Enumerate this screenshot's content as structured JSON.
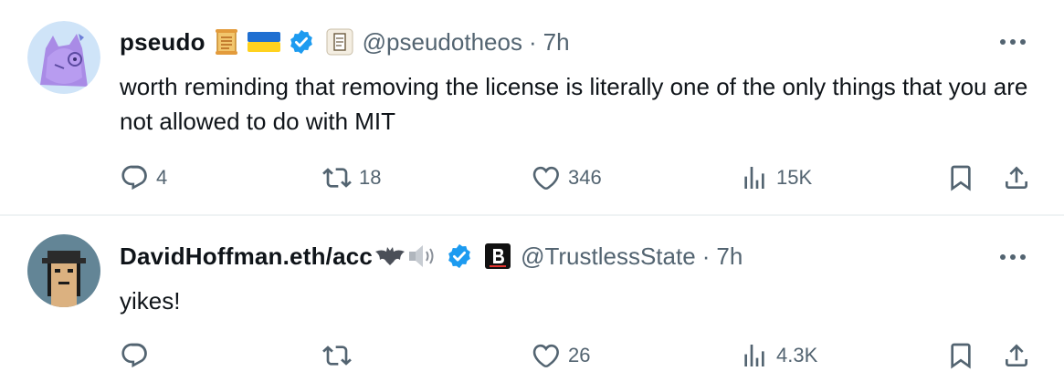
{
  "tweets": [
    {
      "name": "pseudo",
      "handle": "@pseudotheos",
      "dot": "·",
      "time": "7h",
      "text": "worth reminding that removing the license is literally one of the only things that you are not allowed to do with MIT",
      "replies": "4",
      "retweets": "18",
      "likes": "346",
      "views": "15K",
      "badges": [
        "scroll-emoji",
        "ukraine-flag-emoji",
        "verified-badge",
        "scroll-affiliate-badge"
      ]
    },
    {
      "name": "DavidHoffman.eth/acc",
      "handle": "@TrustlessState",
      "dot": "·",
      "time": "7h",
      "text": "yikes!",
      "replies": "",
      "retweets": "",
      "likes": "26",
      "views": "4.3K",
      "badges": [
        "bat-emoji",
        "speaker-emoji",
        "verified-badge",
        "bankless-affiliate-badge"
      ]
    }
  ],
  "colors": {
    "text": "#0f1419",
    "muted": "#536471",
    "verified": "#1d9bf0",
    "divider": "#eff3f4"
  }
}
